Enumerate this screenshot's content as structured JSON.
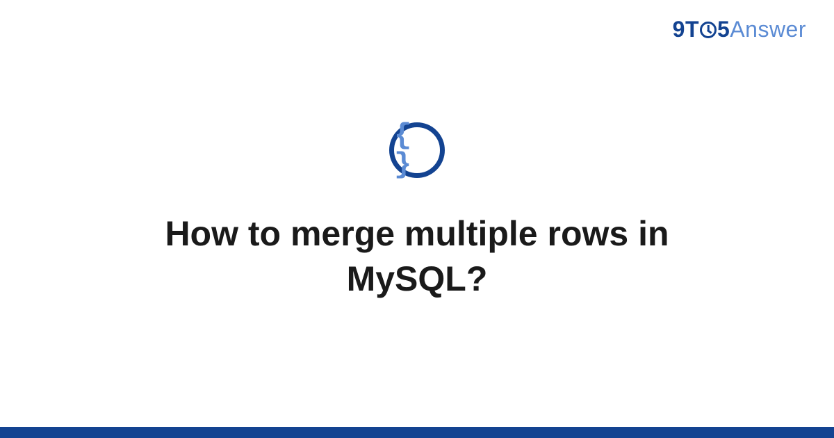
{
  "header": {
    "logo": {
      "part_9": "9",
      "part_t": "T",
      "part_5": "5",
      "part_answer": "Answer"
    }
  },
  "main": {
    "icon": "code-braces-icon",
    "braces_glyph": "{ }",
    "title": "How to merge multiple rows in MySQL?"
  },
  "colors": {
    "brand_dark": "#134391",
    "brand_light": "#5b8bd4",
    "text": "#1a1a1a",
    "background": "#ffffff"
  }
}
